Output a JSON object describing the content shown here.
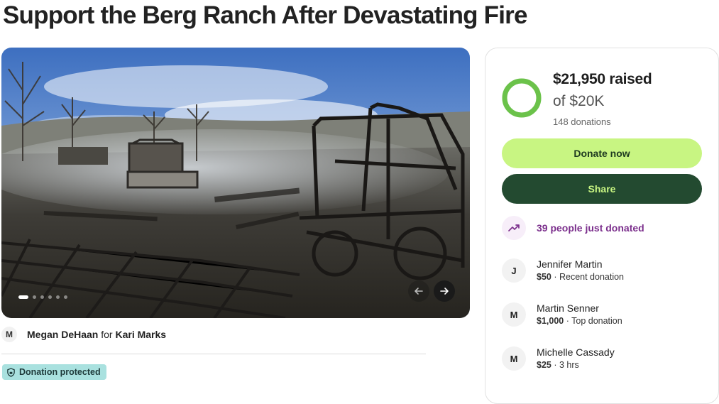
{
  "page": {
    "title": "Support the Berg Ranch After Devastating Fire"
  },
  "carousel": {
    "slide_count": 6,
    "active_index": 0,
    "prev_icon": "arrow-left-icon",
    "next_icon": "arrow-right-icon"
  },
  "organizer": {
    "avatar_initial": "M",
    "name": "Megan DeHaan",
    "connector": "for",
    "beneficiary": "Kari Marks"
  },
  "badge": {
    "label": "Donation protected",
    "icon": "shield-icon"
  },
  "donation": {
    "raised": "$21,950 raised",
    "goal": "of $20K",
    "count": "148 donations",
    "progress_fraction": 1.0,
    "donate_label": "Donate now",
    "share_label": "Share",
    "trending_text": "39 people just donated",
    "trending_icon": "trending-up-icon"
  },
  "donors": [
    {
      "initial": "J",
      "name": "Jennifer Martin",
      "amount": "$50",
      "note": " · Recent donation"
    },
    {
      "initial": "M",
      "name": "Martin Senner",
      "amount": "$1,000",
      "note": " · Top donation"
    },
    {
      "initial": "M",
      "name": "Michelle Cassady",
      "amount": "$25",
      "note": " · 3 hrs"
    }
  ],
  "colors": {
    "accent_green": "#c8f582",
    "dark_green": "#234a30",
    "ring_green": "#6bc24a",
    "trend_purple": "#7b2f8c",
    "badge_teal": "#a9e1df"
  }
}
